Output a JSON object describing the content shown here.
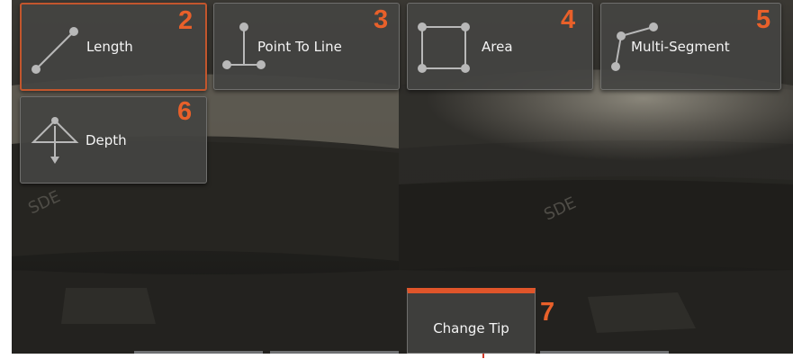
{
  "toolbar": {
    "items": [
      {
        "label": "Length",
        "number": "2",
        "icon": "length-icon",
        "active": true
      },
      {
        "label": "Point To Line",
        "number": "3",
        "icon": "point-to-line-icon",
        "active": false
      },
      {
        "label": "Area",
        "number": "4",
        "icon": "area-icon",
        "active": false
      },
      {
        "label": "Multi-Segment",
        "number": "5",
        "icon": "multi-segment-icon",
        "active": false
      },
      {
        "label": "Depth",
        "number": "6",
        "icon": "depth-icon",
        "active": false
      }
    ]
  },
  "footer": {
    "change_tip_label": "Change Tip",
    "change_tip_number": "7"
  },
  "colors": {
    "accent": "#e8602a",
    "active_border": "#c2562d",
    "button_bg": "#444442"
  }
}
